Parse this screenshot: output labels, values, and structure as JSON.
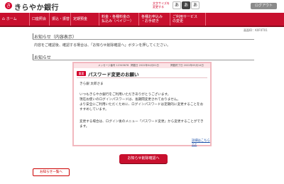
{
  "header": {
    "logo_mark": "き",
    "bank_name": "きらやか銀行",
    "fontsize_label": "文字サイズを変更する",
    "fontsize_small": "あ",
    "fontsize_mid": "あ",
    "fontsize_large": "あ",
    "logout": "ログアウト"
  },
  "nav": {
    "home": "ホーム",
    "inquiry": "口座照会",
    "transfer": "振込・振替",
    "fixed": "定期預金",
    "fee_line1": "料金・各種料金の",
    "fee_line2": "払込み（ペイジー）",
    "travel_line1": "各種お申込み",
    "travel_line2": "・お手続き",
    "settings_line1": "ご利用サービス",
    "settings_line2": "の変更"
  },
  "breadcrumb": "画面ID：K0F0T01",
  "page": {
    "title": "お知らせ（内容表示）",
    "intro": "内容をご確認後、確認する場合は、「お知らせ削除確認へ」ボタンを押してください。",
    "section_title": "お知らせ"
  },
  "message": {
    "meta_number": "メッセージ番号 12345678",
    "meta_date": "掲載日 2022年04月01日",
    "meta_expire": "掲載終了日 2022年05月14日",
    "badge": "重要",
    "subject": "パスワード変更のお願い",
    "recipient": "きら銀 太郎さま",
    "body_lines": [
      "いつもきらやか銀行をご利用いただきありがとうございます。",
      "現在お使いのログインパスワードは、長期間変更されておりません。",
      "より安全にご利用いただくために、ログインパスワードは定期的に変更することをお",
      "すすめしています。",
      "変更する場合は、ログイン後のメニュー「パスワード変更」から変更することができ",
      "ます。"
    ],
    "detail_link": "詳細はこちら>>"
  },
  "actions": {
    "delete_confirm": "お知らせ削除確認へ",
    "back_to_list": "お知らせ一覧へ"
  }
}
